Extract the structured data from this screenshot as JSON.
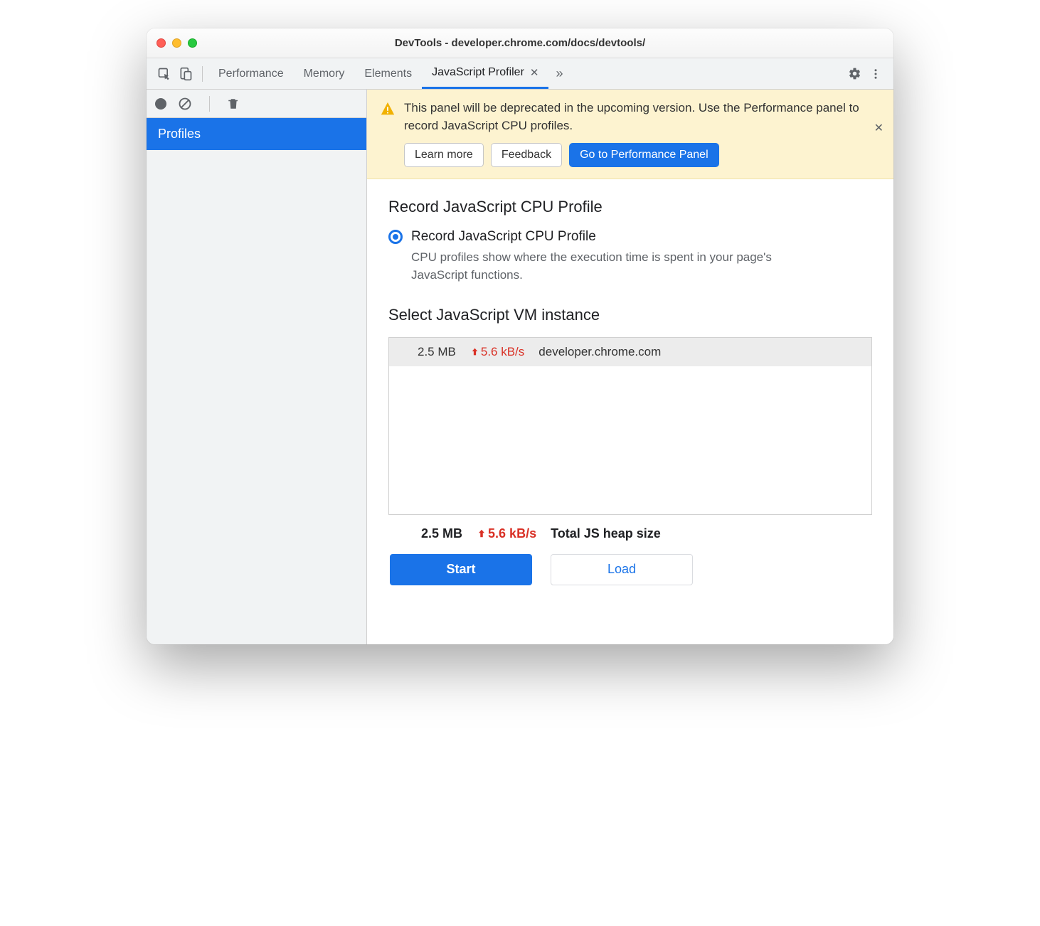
{
  "window": {
    "title": "DevTools - developer.chrome.com/docs/devtools/"
  },
  "tabs": {
    "items": [
      "Performance",
      "Memory",
      "Elements",
      "JavaScript Profiler"
    ],
    "activeIndex": 3
  },
  "sidebar": {
    "header": "Profiles"
  },
  "banner": {
    "text": "This panel will be deprecated in the upcoming version. Use the Performance panel to record JavaScript CPU profiles.",
    "buttons": {
      "learn_more": "Learn more",
      "feedback": "Feedback",
      "goto": "Go to Performance Panel"
    }
  },
  "panel": {
    "record_heading": "Record JavaScript CPU Profile",
    "option_label": "Record JavaScript CPU Profile",
    "option_desc": "CPU profiles show where the execution time is spent in your page's JavaScript functions.",
    "vm_heading": "Select JavaScript VM instance",
    "vm_row": {
      "size": "2.5 MB",
      "rate": "5.6 kB/s",
      "host": "developer.chrome.com"
    },
    "totals": {
      "size": "2.5 MB",
      "rate": "5.6 kB/s",
      "label": "Total JS heap size"
    },
    "start": "Start",
    "load": "Load"
  }
}
